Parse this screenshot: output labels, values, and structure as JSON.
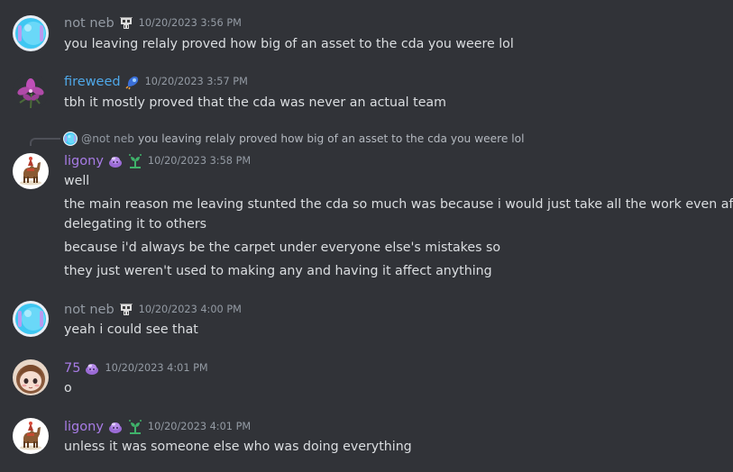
{
  "colors": {
    "background": "#313338",
    "text": "#dbdee1",
    "muted": "#949ba4",
    "name_not_neb": "#949ba4",
    "name_fireweed": "#4fa8e8",
    "name_ligony": "#a87ce6",
    "name_75": "#a87ce6"
  },
  "messages": [
    {
      "author": "not neb",
      "badges": [
        "skull-badge-icon"
      ],
      "timestamp": "10/20/2023 3:56 PM",
      "lines": [
        "you leaving relaly proved how big of an asset to the cda you weere lol"
      ]
    },
    {
      "author": "fireweed",
      "badges": [
        "rocket-badge-icon"
      ],
      "timestamp": "10/20/2023 3:57 PM",
      "lines": [
        "tbh it mostly proved that the cda was never an actual team"
      ]
    },
    {
      "reply_to": {
        "author": "@not neb",
        "text": "you leaving relaly proved how big of an asset to the cda you weere lol"
      },
      "author": "ligony",
      "badges": [
        "purple-blob-badge-icon",
        "sprout-badge-icon"
      ],
      "timestamp": "10/20/2023 3:58 PM",
      "lines": [
        "well",
        "the main reason me leaving stunted the cda so much was because i would just take all the work even after",
        "delegating it to others",
        "because i'd always be the carpet under everyone else's mistakes so",
        "they just weren't used to making any and having it affect anything"
      ]
    },
    {
      "author": "not neb",
      "badges": [
        "skull-badge-icon"
      ],
      "timestamp": "10/20/2023 4:00 PM",
      "lines": [
        "yeah i could see that"
      ]
    },
    {
      "author": "75",
      "badges": [
        "purple-blob-badge-icon"
      ],
      "timestamp": "10/20/2023 4:01 PM",
      "lines": [
        "o"
      ]
    },
    {
      "author": "ligony",
      "badges": [
        "purple-blob-badge-icon",
        "sprout-badge-icon"
      ],
      "timestamp": "10/20/2023 4:01 PM",
      "lines": [
        "unless it was someone else who was doing everything"
      ]
    }
  ]
}
